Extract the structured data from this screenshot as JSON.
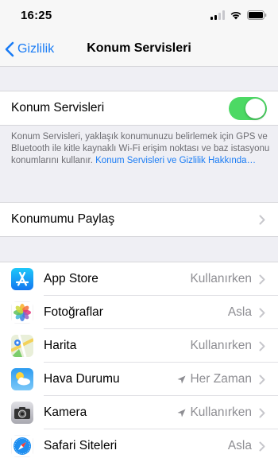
{
  "status_bar": {
    "time": "16:25",
    "icons": [
      "signal-icon",
      "wifi-icon",
      "battery-icon"
    ]
  },
  "nav": {
    "back_label": "Gizlilik",
    "title": "Konum Servisleri"
  },
  "location_services": {
    "label": "Konum Servisleri",
    "enabled": true,
    "accent": "#4cd964"
  },
  "footer": {
    "text": "Konum Servisleri, yaklaşık konumunuzu belirlemek için GPS ve Bluetooth ile kitle kaynaklı Wi-Fi erişim noktası ve baz istasyonu konumlarını kullanır.",
    "link": "Konum Servisleri ve Gizlilik Hakkında…",
    "link_color": "#1a7cf5"
  },
  "share_location": {
    "label": "Konumumu Paylaş"
  },
  "apps": [
    {
      "name": "App Store",
      "value": "Kullanırken",
      "icon": "app-store-icon",
      "location_arrow": false
    },
    {
      "name": "Fotoğraflar",
      "value": "Asla",
      "icon": "photos-icon",
      "location_arrow": false
    },
    {
      "name": "Harita",
      "value": "Kullanırken",
      "icon": "maps-icon",
      "location_arrow": false
    },
    {
      "name": "Hava Durumu",
      "value": "Her Zaman",
      "icon": "weather-icon",
      "location_arrow": true
    },
    {
      "name": "Kamera",
      "value": "Kullanırken",
      "icon": "camera-icon",
      "location_arrow": true
    },
    {
      "name": "Safari Siteleri",
      "value": "Asla",
      "icon": "safari-icon",
      "location_arrow": false
    }
  ]
}
